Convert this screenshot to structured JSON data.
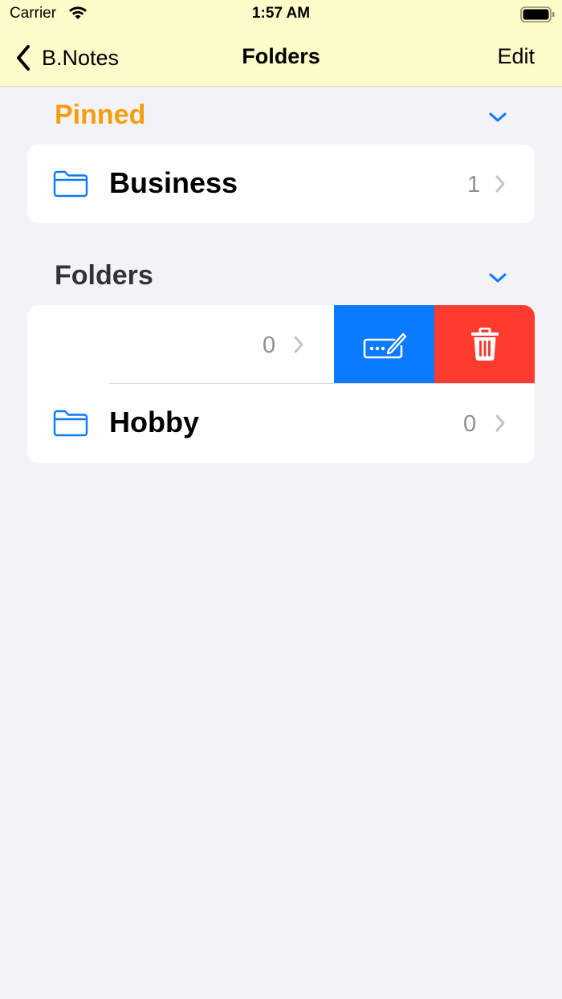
{
  "status_bar": {
    "carrier": "Carrier",
    "time": "1:57 AM"
  },
  "nav": {
    "back_label": "B.Notes",
    "title": "Folders",
    "edit_label": "Edit"
  },
  "sections": {
    "pinned": {
      "title": "Pinned",
      "title_color": "#f59e0b",
      "items": [
        {
          "label": "Business",
          "count": "1",
          "icon": "folder-icon"
        }
      ]
    },
    "folders": {
      "title": "Folders",
      "items": [
        {
          "label": "",
          "count": "0",
          "swiped": true,
          "actions": [
            "rename-icon",
            "trash-icon"
          ]
        },
        {
          "label": "Hobby",
          "count": "0",
          "icon": "folder-icon"
        }
      ]
    }
  },
  "colors": {
    "header_bg": "#fefcc9",
    "accent_blue": "#0a7aff",
    "delete_red": "#ff3b30",
    "background": "#f2f2f7"
  }
}
